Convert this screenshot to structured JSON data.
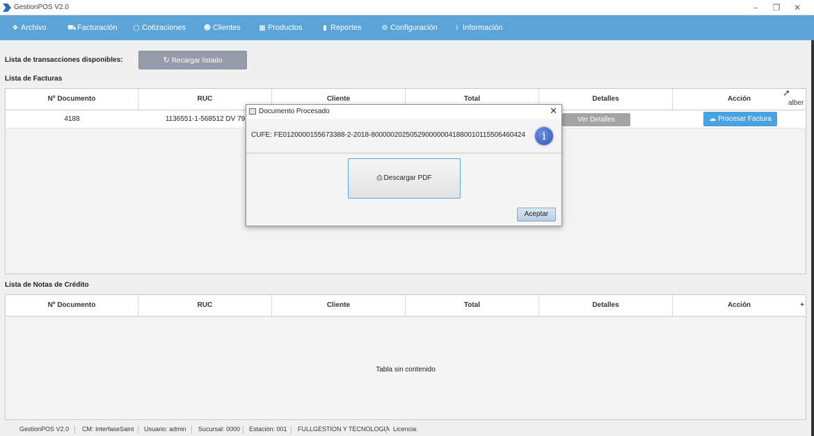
{
  "window": {
    "title": "GestionPOS V2.0",
    "controls": {
      "minimize": "–",
      "restore": "❐",
      "close": "✕"
    }
  },
  "menu": [
    {
      "label": "Archivo",
      "icon": "cubes-icon",
      "glyph": "❖"
    },
    {
      "label": "Facturación",
      "icon": "cart-icon",
      "glyph": "⛟"
    },
    {
      "label": "Cotizaciones",
      "icon": "document-icon",
      "glyph": "▢"
    },
    {
      "label": "Clientes",
      "icon": "users-icon",
      "glyph": "☻"
    },
    {
      "label": "Productos",
      "icon": "grid-icon",
      "glyph": "▦"
    },
    {
      "label": "Reportes",
      "icon": "bar-chart-icon",
      "glyph": "▮"
    },
    {
      "label": "Configuración",
      "icon": "gear-icon",
      "glyph": "⚙"
    },
    {
      "label": "Información",
      "icon": "info-icon",
      "glyph": "i"
    }
  ],
  "transactions_label": "Lista de transacciones disponibles:",
  "reload_button": {
    "label": "Recargar listado",
    "glyph": "↻"
  },
  "facturas": {
    "title": "Lista de Facturas",
    "columns": [
      "Nº Documento",
      "RUC",
      "Cliente",
      "Total",
      "Detalles",
      "Acción"
    ],
    "rows": [
      {
        "documento": "4188",
        "ruc": "1136551-1-568512  DV 79",
        "detalles": "Ver Detalles",
        "accion": "Procesar Factura"
      }
    ],
    "overflow_text": "alber"
  },
  "notas": {
    "title": "Lista de Notas de Crédito",
    "columns": [
      "Nº Documento",
      "RUC",
      "Cliente",
      "Total",
      "Detalles",
      "Acción"
    ],
    "plus": "+",
    "empty": "Tabla sin contenido"
  },
  "status": {
    "app": "GestionPOS V2.0",
    "cm": "CM: InterfaseSaint",
    "usuario": "Usuario: admin",
    "sucursal": "Sucursal: 0000",
    "estacion": "Estación: 001",
    "empresa": "FULLGESTION Y TECNOLOGIA",
    "licencia": "Licencia:"
  },
  "dialog": {
    "title": "Documento Procesado",
    "close": "✕",
    "cufe": "CUFE: FE0120000155673388-2-2018-8000002025052900000041880010115506460424",
    "info_glyph": "i",
    "pdf_button": "Descargar PDF",
    "pdf_glyph": "⎙",
    "ok_button": "Aceptar"
  }
}
